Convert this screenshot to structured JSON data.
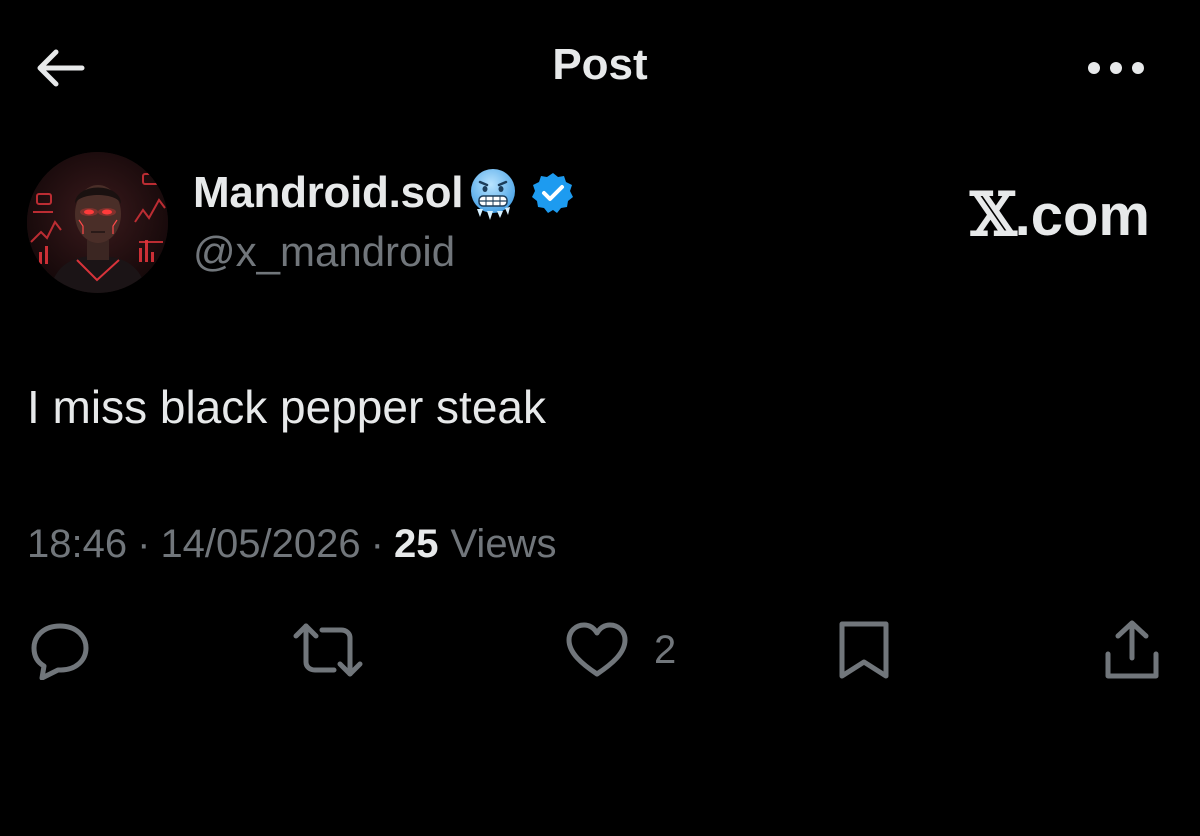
{
  "header": {
    "title": "Post",
    "back_icon": "arrow-left-icon",
    "more_icon": "more-horizontal-icon"
  },
  "author": {
    "display_name": "Mandroid.sol",
    "handle": "@x_mandroid",
    "emoji_icon": "cold-face-emoji-icon",
    "verified_icon": "verified-badge-icon",
    "verified_color": "#1d9bf0"
  },
  "watermark": {
    "x_mark": "𝕏",
    "domain": ".com"
  },
  "post": {
    "text": "I miss black pepper steak",
    "time": "18:46",
    "date": "14/05/2026",
    "separator": "·",
    "views_count": "25",
    "views_label": "Views"
  },
  "actions": {
    "reply_icon": "reply-icon",
    "repost_icon": "repost-icon",
    "like_icon": "heart-icon",
    "like_count": "2",
    "bookmark_icon": "bookmark-icon",
    "share_icon": "share-icon"
  },
  "colors": {
    "background": "#000000",
    "primary_text": "#e7e9ea",
    "secondary_text": "#71767b",
    "accent": "#1d9bf0"
  }
}
